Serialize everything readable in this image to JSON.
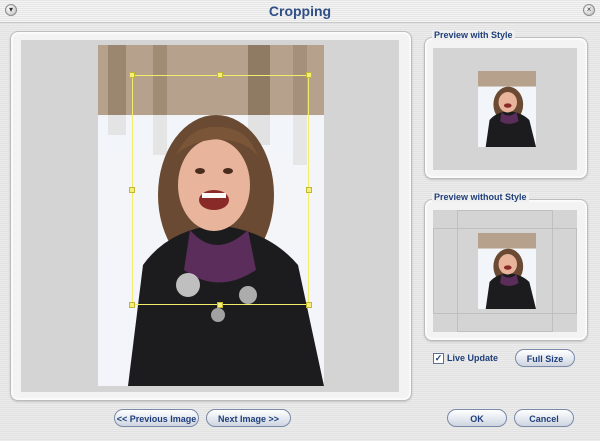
{
  "window": {
    "title": "Cropping",
    "menu_icon": "chevron-down-icon",
    "close_icon": "close-icon"
  },
  "preview_with_style": {
    "label": "Preview with Style"
  },
  "preview_without_style": {
    "label": "Preview without Style"
  },
  "options": {
    "live_update_label": "Live Update",
    "live_update_checked": true,
    "full_size_label": "Full Size"
  },
  "nav": {
    "previous_label": "<< Previous Image",
    "next_label": "Next Image >>"
  },
  "dialog": {
    "ok_label": "OK",
    "cancel_label": "Cancel"
  },
  "colors": {
    "title": "#2f4f86",
    "crop_frame": "#f2ec6a",
    "button_text": "#1f3f7a"
  }
}
